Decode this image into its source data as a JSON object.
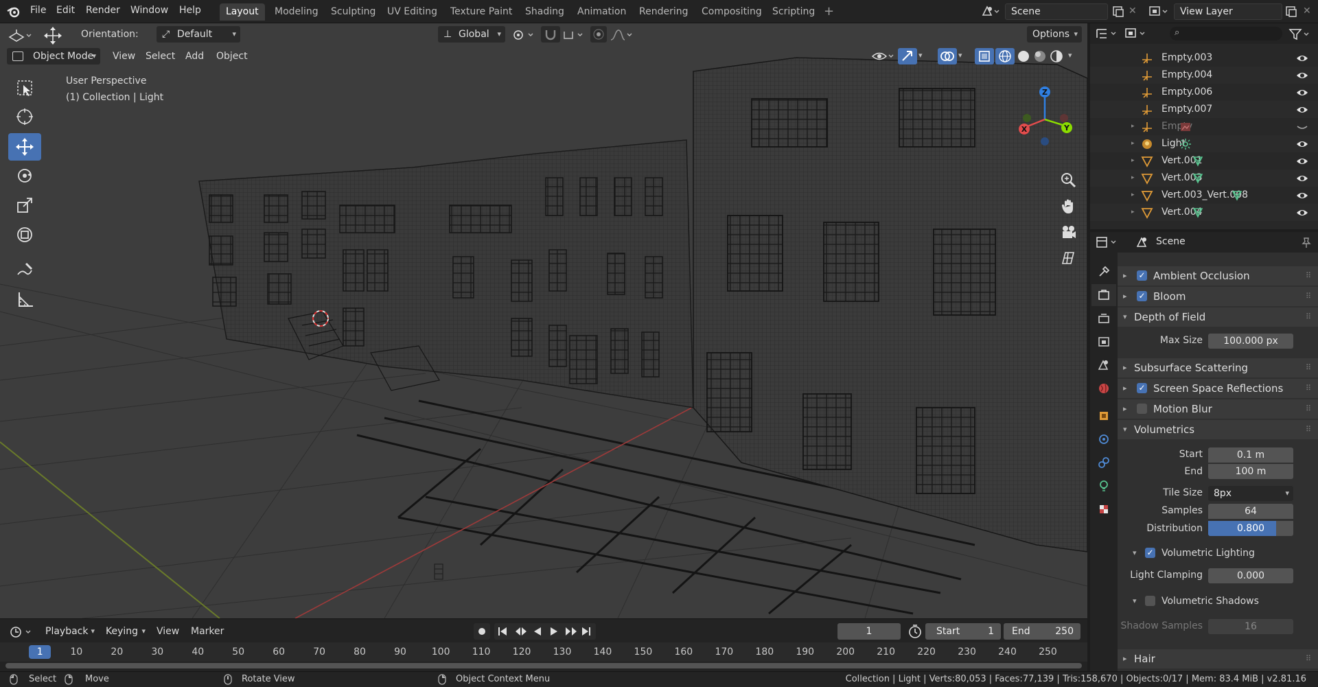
{
  "menu": {
    "items": [
      "File",
      "Edit",
      "Render",
      "Window",
      "Help"
    ]
  },
  "workspaces": [
    "Layout",
    "Modeling",
    "Sculpting",
    "UV Editing",
    "Texture Paint",
    "Shading",
    "Animation",
    "Rendering",
    "Compositing",
    "Scripting"
  ],
  "active_workspace": "Layout",
  "scene": {
    "name": "Scene",
    "view_layer": "View Layer"
  },
  "viewport_header": {
    "orientation_label": "Orientation:",
    "orientation_value": "Default",
    "transform_orientation": "Global",
    "options": "Options",
    "mode": "Object Mode",
    "view": "View",
    "select": "Select",
    "add": "Add",
    "object": "Object"
  },
  "viewport_info": {
    "perspective": "User Perspective",
    "collection": "(1) Collection | Light"
  },
  "gizmo": {
    "x": "X",
    "y": "Y",
    "z": "Z"
  },
  "outliner": {
    "search_placeholder": "",
    "items": [
      {
        "name": "Empty.003",
        "type": "empty",
        "dim": false
      },
      {
        "name": "Empty.004",
        "type": "empty",
        "dim": false
      },
      {
        "name": "Empty.006",
        "type": "empty",
        "dim": false
      },
      {
        "name": "Empty.007",
        "type": "empty",
        "dim": false
      },
      {
        "name": "Empty",
        "type": "empty",
        "dim": true
      },
      {
        "name": "Light",
        "type": "light",
        "dim": false
      },
      {
        "name": "Vert.001",
        "type": "mesh",
        "dim": false
      },
      {
        "name": "Vert.003",
        "type": "mesh",
        "dim": false
      },
      {
        "name": "Vert.003_Vert.008",
        "type": "mesh",
        "dim": false
      },
      {
        "name": "Vert.004",
        "type": "mesh",
        "dim": false
      }
    ]
  },
  "properties": {
    "context": "Scene",
    "panels": {
      "ambient_occlusion": "Ambient Occlusion",
      "bloom": "Bloom",
      "depth_of_field": "Depth of Field",
      "max_size_label": "Max Size",
      "max_size_value": "100.000 px",
      "subsurface": "Subsurface Scattering",
      "ssr": "Screen Space Reflections",
      "motion_blur": "Motion Blur",
      "volumetrics": "Volumetrics",
      "start_label": "Start",
      "start_value": "0.1 m",
      "end_label": "End",
      "end_value": "100 m",
      "tile_size_label": "Tile Size",
      "tile_size_value": "8px",
      "samples_label": "Samples",
      "samples_value": "64",
      "distribution_label": "Distribution",
      "distribution_value": "0.800",
      "distribution_fraction": 0.8,
      "vol_lighting": "Volumetric Lighting",
      "light_clamping_label": "Light Clamping",
      "light_clamping_value": "0.000",
      "vol_shadows": "Volumetric Shadows",
      "shadow_samples_label": "Shadow Samples",
      "shadow_samples_value": "16",
      "hair": "Hair"
    }
  },
  "timeline": {
    "playback": "Playback",
    "keying": "Keying",
    "view": "View",
    "marker": "Marker",
    "current_frame": "1",
    "start_label": "Start",
    "start_value": "1",
    "end_label": "End",
    "end_value": "250",
    "ticks": [
      "1",
      "10",
      "20",
      "30",
      "40",
      "50",
      "60",
      "70",
      "80",
      "90",
      "100",
      "110",
      "120",
      "130",
      "140",
      "150",
      "160",
      "170",
      "180",
      "190",
      "200",
      "210",
      "220",
      "230",
      "240",
      "250"
    ]
  },
  "status": {
    "select": "Select",
    "move": "Move",
    "rotate": "Rotate View",
    "context_menu": "Object Context Menu",
    "stats": "Collection | Light | Verts:80,053 | Faces:77,139 | Tris:158,670 | Objects:0/17 | Mem: 83.4 MiB | v2.81.16"
  },
  "colors": {
    "accent": "#4772b3",
    "x_axis": "#e24c4c",
    "y_axis": "#8bdc00",
    "z_axis": "#2f7fe2",
    "light_icon": "#c78a2c",
    "mesh_icon": "#e09b37"
  }
}
